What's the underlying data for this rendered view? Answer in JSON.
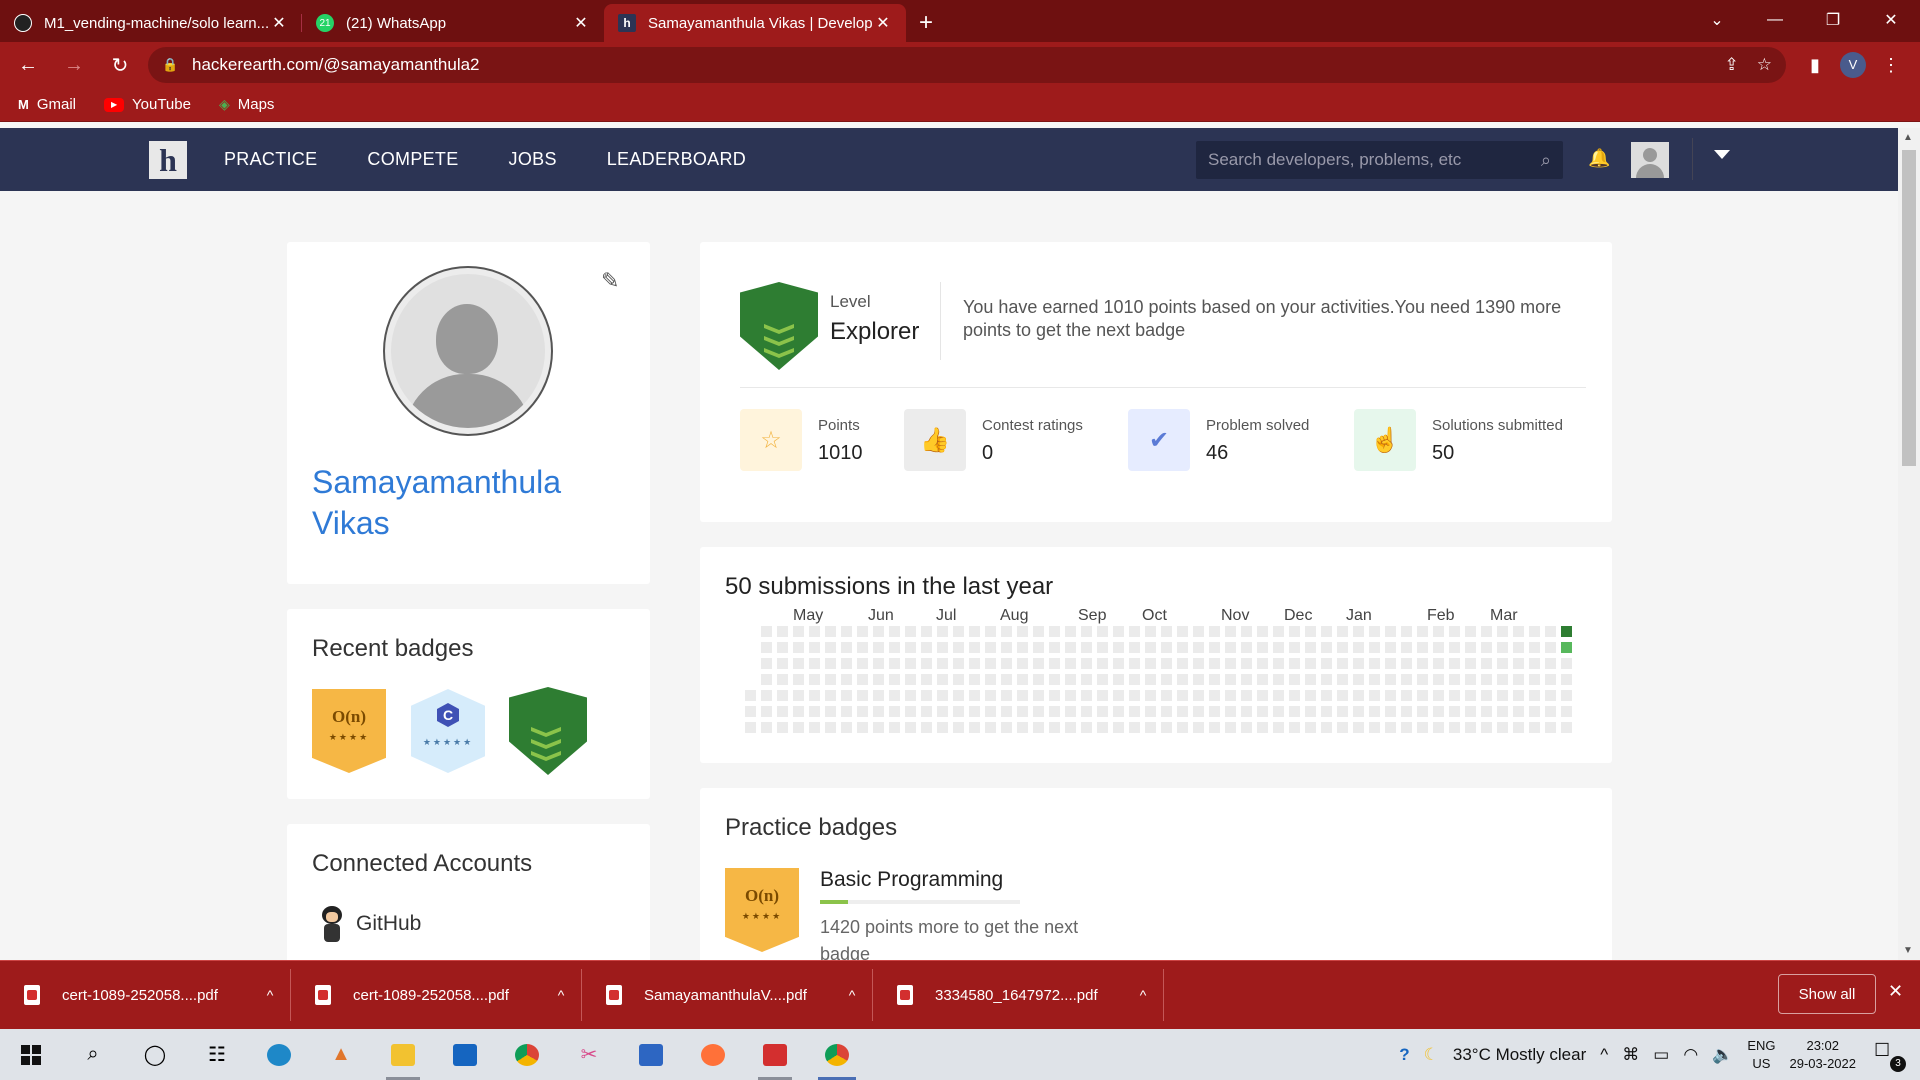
{
  "browser": {
    "tabs": [
      {
        "title": "M1_vending-machine/solo learn...",
        "favicon": "github-icon"
      },
      {
        "title": "(21) WhatsApp",
        "favicon": "whatsapp-icon"
      },
      {
        "title": "Samayamanthula Vikas | Develop...",
        "favicon": "hackerearth-icon"
      }
    ],
    "url": "hackerearth.com/@samayamanthula2",
    "profile_initial": "V",
    "bookmarks": [
      "Gmail",
      "YouTube",
      "Maps"
    ]
  },
  "site": {
    "logo": "h",
    "nav": [
      "PRACTICE",
      "COMPETE",
      "JOBS",
      "LEADERBOARD"
    ],
    "search_placeholder": "Search developers, problems, etc"
  },
  "profile": {
    "name": "Samayamanthula Vikas"
  },
  "recent_badges": {
    "title": "Recent badges",
    "items": [
      {
        "symbol": "O(n)",
        "stars": "★★★★",
        "color": "#f6b745"
      },
      {
        "symbol": "C",
        "sub": "C",
        "stars": "★★★★★",
        "color": "#d6ecfb"
      },
      {
        "symbol": "",
        "color": "#2e7d32"
      }
    ]
  },
  "connected_accounts": {
    "title": "Connected Accounts",
    "github": "GitHub"
  },
  "level": {
    "label": "Level",
    "value": "Explorer",
    "message": "You have earned 1010 points based on your activities.You need 1390 more points to get the next badge"
  },
  "stats": [
    {
      "label": "Points",
      "value": "1010",
      "icon": "star-icon",
      "bg": "#fff4dc",
      "fg": "#f2b544"
    },
    {
      "label": "Contest ratings",
      "value": "0",
      "icon": "thumbs-up-icon",
      "bg": "#ececec",
      "fg": "#888"
    },
    {
      "label": "Problem solved",
      "value": "46",
      "icon": "check-circle-icon",
      "bg": "#e6ecff",
      "fg": "#5b7bd6"
    },
    {
      "label": "Solutions submitted",
      "value": "50",
      "icon": "pointer-icon",
      "bg": "#e6f7ec",
      "fg": "#4caf50"
    }
  ],
  "submissions": {
    "title": "50 submissions in the last year",
    "months": [
      "May",
      "Jun",
      "Jul",
      "Aug",
      "Sep",
      "Oct",
      "Nov",
      "Dec",
      "Jan",
      "Feb",
      "Mar"
    ],
    "colors": {
      "empty": "#ebebeb",
      "dark": "#2e7d32",
      "light": "#57b85c"
    }
  },
  "practice_badges": {
    "title": "Practice badges",
    "badge_symbol": "O(n)",
    "badge_stars": "★★★★",
    "name": "Basic Programming",
    "progress": 0.14,
    "desc": "1420 points more to get the next badge"
  },
  "downloads": {
    "files": [
      "cert-1089-252058....pdf",
      "cert-1089-252058....pdf",
      "SamayamanthulaV....pdf",
      "3334580_1647972....pdf"
    ],
    "show_all": "Show all"
  },
  "taskbar": {
    "weather": "33°C  Mostly clear",
    "lang_top": "ENG",
    "lang_bottom": "US",
    "time": "23:02",
    "date": "29-03-2022",
    "notif_count": "3"
  }
}
